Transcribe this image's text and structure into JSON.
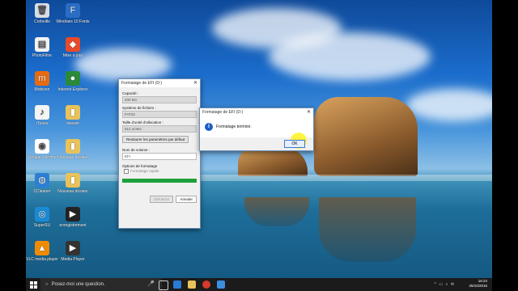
{
  "desktop": {
    "icons": [
      {
        "label": "Corbeille",
        "icon": "recycle-bin-icon",
        "color": "#d8dde5",
        "glyph": "🗑"
      },
      {
        "label": "Windows 10 Fonts",
        "icon": "fonts-icon",
        "color": "#2b6cc4",
        "glyph": "F"
      },
      {
        "label": "PhotoFiltre",
        "icon": "document-icon",
        "color": "#f2f2f2",
        "glyph": "▤"
      },
      {
        "label": "Mise à jour",
        "icon": "app-icon",
        "color": "#e94a2a",
        "glyph": "◆"
      },
      {
        "label": "Mobizen",
        "icon": "mobizen-icon",
        "color": "#e86a10",
        "glyph": "m"
      },
      {
        "label": "Internet Explorer",
        "icon": "internet-icon",
        "color": "#2a8a3a",
        "glyph": "●"
      },
      {
        "label": "iTunes",
        "icon": "itunes-icon",
        "color": "#f4f4f4",
        "glyph": "♪"
      },
      {
        "label": "dossier",
        "icon": "folder-icon",
        "color": "#e8c25a",
        "glyph": "▮"
      },
      {
        "label": "Google Chrome",
        "icon": "chrome-icon",
        "color": "#ffffff",
        "glyph": "◉"
      },
      {
        "label": "Nouveau dossier",
        "icon": "folder-icon",
        "color": "#e8c25a",
        "glyph": "▮"
      },
      {
        "label": "CCleaner",
        "icon": "ccleaner-icon",
        "color": "#2c7fd4",
        "glyph": "◍"
      },
      {
        "label": "Nouveau dossier",
        "icon": "folder-icon",
        "color": "#e8c25a",
        "glyph": "▮"
      },
      {
        "label": "SuperSU",
        "icon": "app-icon",
        "color": "#1a8ad4",
        "glyph": "◎"
      },
      {
        "label": "enregistrement",
        "icon": "video-icon",
        "color": "#222222",
        "glyph": "▶"
      },
      {
        "label": "VLC media player",
        "icon": "vlc-icon",
        "color": "#f08a00",
        "glyph": "▲"
      },
      {
        "label": "Media Player",
        "icon": "video-icon",
        "color": "#333333",
        "glyph": "▶"
      }
    ]
  },
  "format_window": {
    "title": "Formatage de EFI (D:)",
    "capacity_label": "Capacité :",
    "capacity_value": "200 Mo",
    "fs_label": "Système de fichiers :",
    "fs_value": "FAT32",
    "alloc_label": "Taille d'unité d'allocation :",
    "alloc_value": "512 octets",
    "restore_defaults": "Restaurer les paramètres par défaut",
    "volume_label": "Nom de volume :",
    "volume_value": "EFI",
    "options_label": "Options de formatage",
    "quick_format": "Formatage rapide",
    "start_button": "Démarrer",
    "cancel_button": "Annuler",
    "progress": 1.0
  },
  "message_box": {
    "title": "Formatage de EFI (D:)",
    "message": "Formatage terminé.",
    "ok_label": "OK"
  },
  "taskbar": {
    "search_placeholder": "Posez-moi une question.",
    "time": "16:24",
    "date": "25/10/2016"
  }
}
